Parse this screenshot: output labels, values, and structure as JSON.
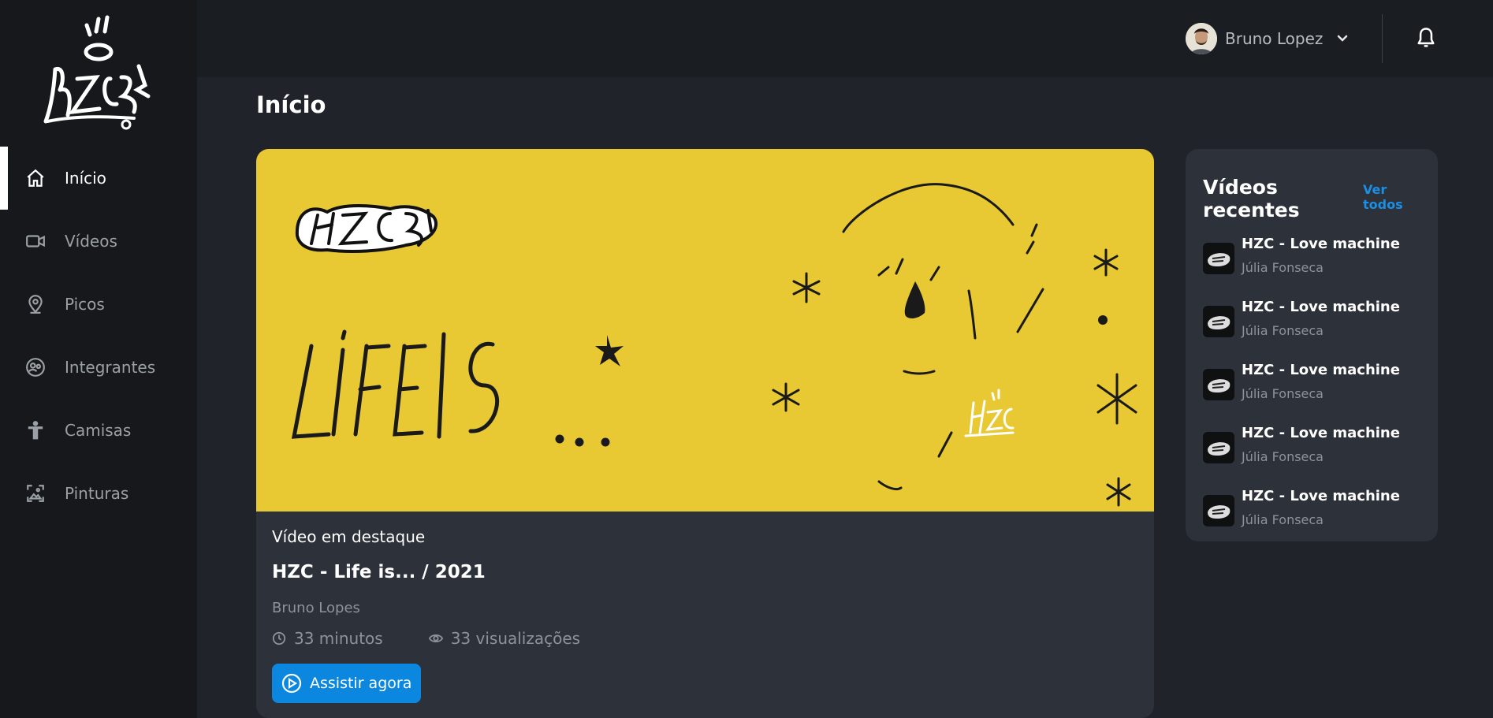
{
  "sidebar": {
    "logo_alt": "HZC",
    "items": [
      {
        "label": "Início",
        "icon": "home-icon",
        "active": true
      },
      {
        "label": "Vídeos",
        "icon": "video-camera-icon"
      },
      {
        "label": "Picos",
        "icon": "map-pin-icon"
      },
      {
        "label": "Integrantes",
        "icon": "users-icon"
      },
      {
        "label": "Camisas",
        "icon": "person-icon"
      },
      {
        "label": "Pinturas",
        "icon": "image-icon"
      }
    ]
  },
  "header": {
    "user_name": "Bruno Lopez",
    "notification_icon": "bell-icon"
  },
  "main": {
    "title": "Início",
    "featured": {
      "banner_text": "LIFE IS ...",
      "kicker": "Vídeo em destaque",
      "title": "HZC - Life is... / 2021",
      "author": "Bruno Lopes",
      "duration": "33 minutos",
      "views": "33 visualizações",
      "watch_label": "Assistir agora"
    },
    "recent": {
      "title": "Vídeos recentes",
      "see_all": "Ver todos",
      "items": [
        {
          "name": "HZC - Love machine",
          "author": "Júlia Fonseca"
        },
        {
          "name": "HZC - Love machine",
          "author": "Júlia Fonseca"
        },
        {
          "name": "HZC - Love machine",
          "author": "Júlia Fonseca"
        },
        {
          "name": "HZC - Love machine",
          "author": "Júlia Fonseca"
        },
        {
          "name": "HZC - Love machine",
          "author": "Júlia Fonseca"
        }
      ]
    }
  },
  "colors": {
    "accent": "#0b87e0",
    "banner": "#e8c833",
    "sidebar_bg": "#16181c",
    "card_bg": "#2d3139"
  }
}
